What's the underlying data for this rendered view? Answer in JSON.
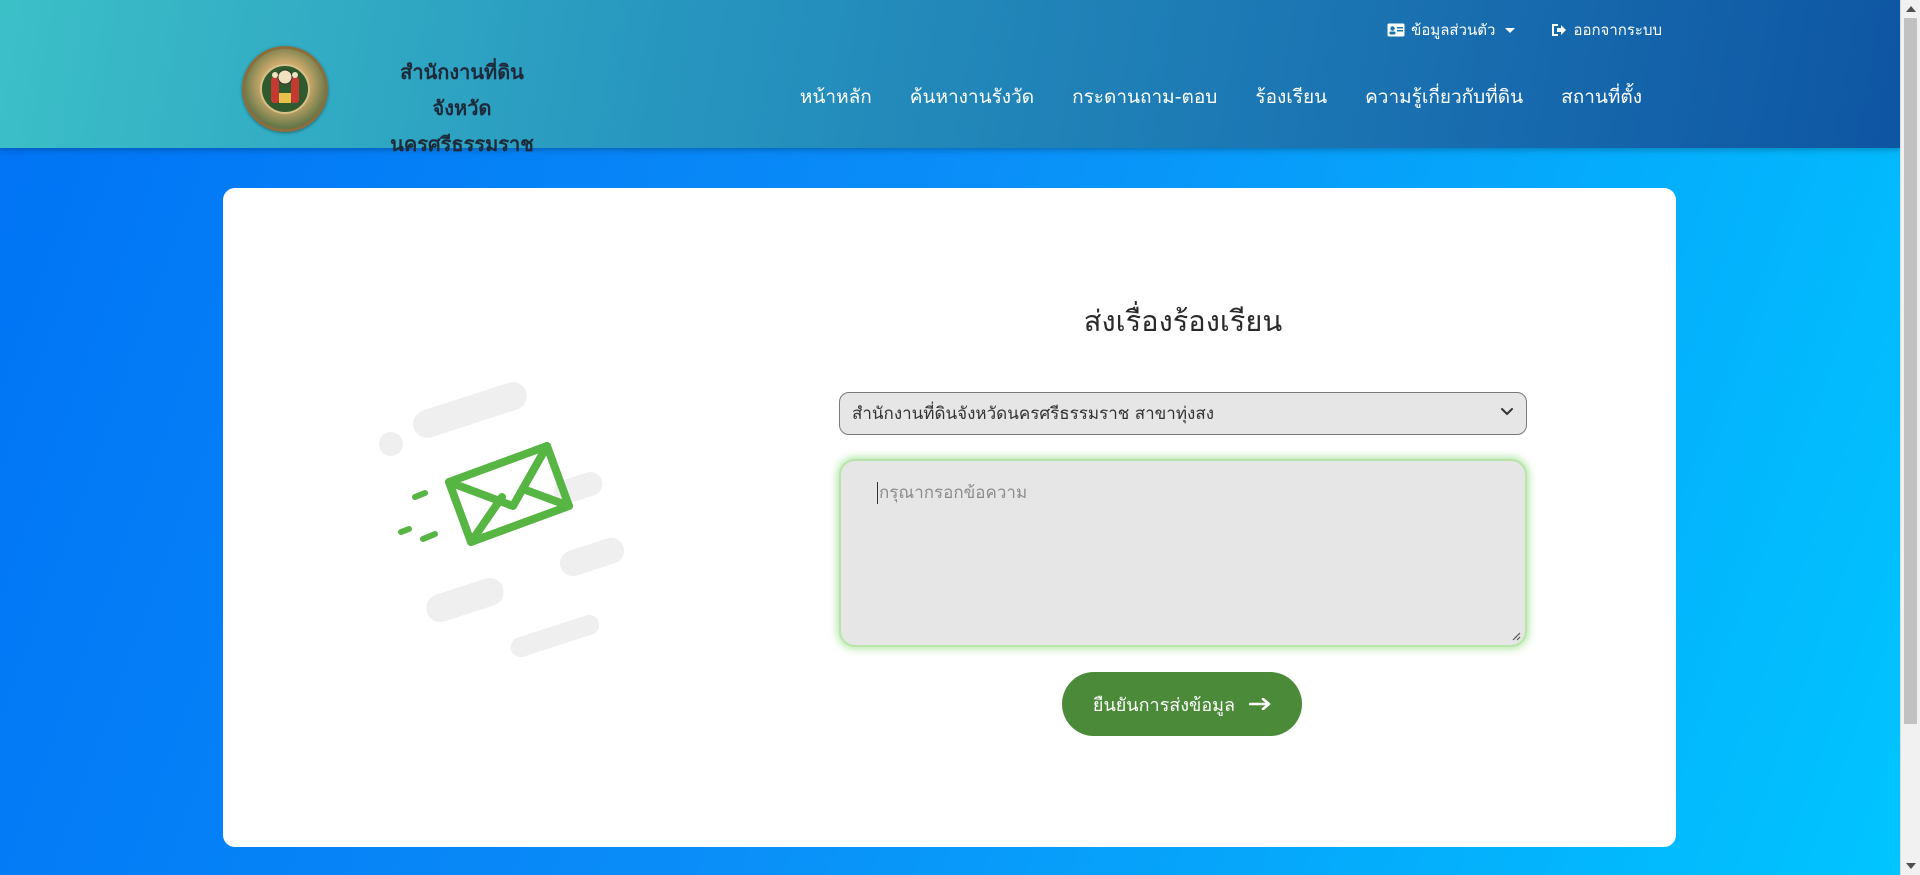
{
  "header": {
    "org_name_line1": "สำนักงานที่ดิน",
    "org_name_line2": "จังหวัดนครศรีธรรมราช",
    "profile_label": "ข้อมูลส่วนตัว",
    "logout_label": "ออกจากระบบ",
    "nav": [
      {
        "label": "หน้าหลัก"
      },
      {
        "label": "ค้นหางานรังวัด"
      },
      {
        "label": "กระดานถาม-ตอบ"
      },
      {
        "label": "ร้องเรียน"
      },
      {
        "label": "ความรู้เกี่ยวกับที่ดิน"
      },
      {
        "label": "สถานที่ตั้ง"
      }
    ]
  },
  "form": {
    "title": "ส่งเรื่องร้องเรียน",
    "branch_selected": "สำนักงานที่ดินจังหวัดนครศรีธรรมราช สาขาทุ่งสง",
    "message_placeholder": "กรุณากรอกข้อความ",
    "submit_label": "ยืนยันการส่งข้อมูล"
  },
  "icons": {
    "envelope": "envelope-icon",
    "profile": "id-card-icon",
    "logout": "sign-out-icon",
    "submit_arrow": "arrow-right-icon"
  },
  "colors": {
    "header_start": "#3cc0c8",
    "header_end": "#0e55a3",
    "background_start": "#0073f5",
    "background_end": "#00c6ff",
    "envelope_green": "#57b543",
    "submit_bg": "#4a8a38"
  }
}
